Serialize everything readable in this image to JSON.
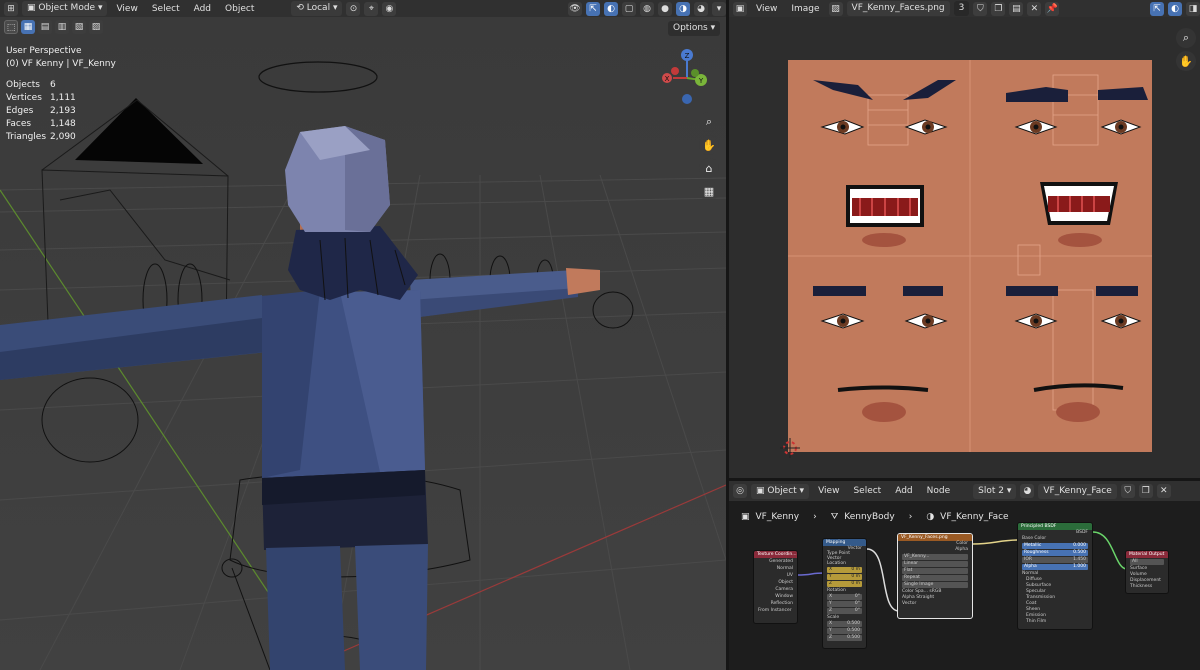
{
  "viewport": {
    "mode_label": "Object Mode",
    "menus": [
      "View",
      "Select",
      "Add",
      "Object"
    ],
    "transform_orientation": "Local",
    "options_label": "Options",
    "perspective_label": "User Perspective",
    "object_label": "(0) VF Kenny | VF_Kenny",
    "stats": [
      {
        "label": "Objects",
        "value": "6"
      },
      {
        "label": "Vertices",
        "value": "1,111"
      },
      {
        "label": "Edges",
        "value": "2,193"
      },
      {
        "label": "Faces",
        "value": "1,148"
      },
      {
        "label": "Triangles",
        "value": "2,090"
      }
    ],
    "gizmo_axes": {
      "z": "Z",
      "y": "Y",
      "x": "X"
    }
  },
  "image_editor": {
    "menus": [
      "View",
      "Image"
    ],
    "image_name": "VF_Kenny_Faces.png",
    "users_count": "3"
  },
  "node_editor": {
    "object_label": "Object",
    "menus": [
      "View",
      "Select",
      "Add",
      "Node"
    ],
    "slot_label": "Slot 2",
    "material_name": "VF_Kenny_Face",
    "breadcrumb": [
      "VF_Kenny",
      "KennyBody",
      "VF_Kenny_Face"
    ],
    "nodes": {
      "texcoord": {
        "title": "Texture Coordin...",
        "outputs": [
          "Generated",
          "Normal",
          "UV",
          "Object",
          "Camera",
          "Window",
          "Reflection"
        ],
        "footer": "From Instancer"
      },
      "mapping": {
        "title": "Mapping",
        "rows": [
          "Vector",
          "Type",
          "Point",
          "Vector",
          "Location",
          "X",
          "0 m",
          "Y",
          "0 m",
          "Z",
          "0 m",
          "Rotation",
          "X",
          "0°",
          "Y",
          "0°",
          "Z",
          "0°",
          "Scale",
          "X",
          "0.500",
          "Y",
          "0.500",
          "Z",
          "0.500"
        ]
      },
      "image": {
        "title": "VF_Kenny_Faces.png",
        "rows": [
          "Color",
          "Alpha",
          "VF_Kenny...",
          "Linear",
          "Flat",
          "Repeat",
          "Single Image",
          "Color Spa...",
          "sRGB",
          "Alpha",
          "Straight",
          "Vector"
        ]
      },
      "principled": {
        "title": "Principled BSDF",
        "rows": [
          "BSDF",
          "Base Color",
          "Metallic",
          "0.000",
          "Roughness",
          "0.500",
          "IOR",
          "1.450",
          "Alpha",
          "1.000",
          "Normal",
          "Diffuse",
          "Subsurface",
          "Specular",
          "Transmission",
          "Coat",
          "Sheen",
          "Emission",
          "Thin Film"
        ]
      },
      "output": {
        "title": "Material Output",
        "rows": [
          "All",
          "Surface",
          "Volume",
          "Displacement",
          "Thickness"
        ]
      }
    }
  },
  "colors": {
    "header_bg": "#303030",
    "viewport_bg": "#3d3d3d",
    "accent_blue": "#4772b3",
    "skin": "#c17a5c",
    "node_green": "#2b6c3a",
    "node_orange": "#9a5a24",
    "node_red": "#8a2a3a",
    "node_blue": "#345a8a"
  }
}
